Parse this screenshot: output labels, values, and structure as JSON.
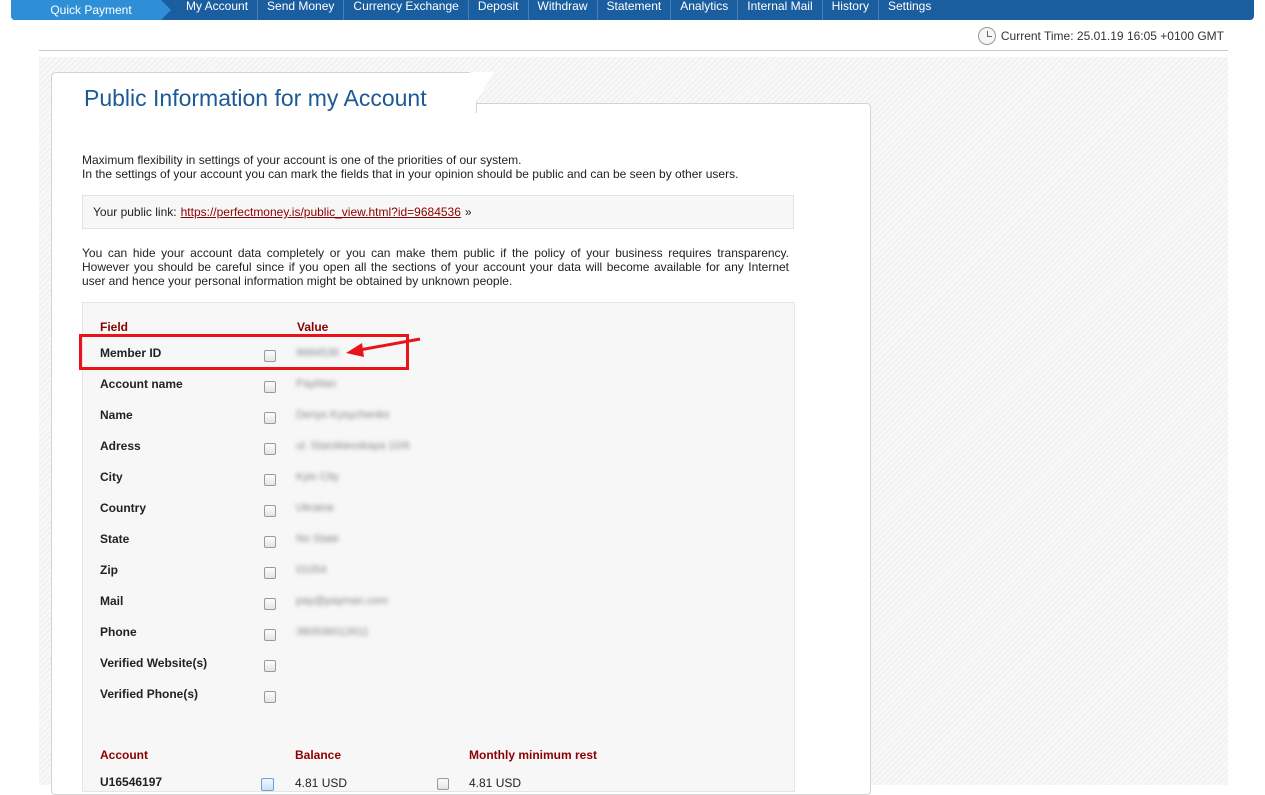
{
  "nav": {
    "quick_payment": "Quick Payment",
    "items": [
      "My Account",
      "Send Money",
      "Currency Exchange",
      "Deposit",
      "Withdraw",
      "Statement",
      "Analytics",
      "Internal Mail",
      "History",
      "Settings"
    ]
  },
  "header": {
    "current_time": "Current Time: 25.01.19 16:05 +0100 GMT"
  },
  "page": {
    "title": "Public Information for my Account",
    "intro_line1": "Maximum flexibility in settings of your account is one of the priorities of our system.",
    "intro_line2": "In the settings of your account you can mark the fields that in your opinion should be public and can be seen by other users.",
    "public_link_label": "Your public link:",
    "public_link_url": "https://perfectmoney.is/public_view.html?id=9684536",
    "public_link_suffix": "»",
    "warning": "You can hide your account data completely or you can make them public if the policy of your business requires transparency. However you should be careful since if you open all the sections of your account your data will become available for any Internet user and hence your personal information might be obtained by unknown people."
  },
  "fields_table": {
    "header_field": "Field",
    "header_value": "Value",
    "rows": [
      {
        "label": "Member ID",
        "value": "9684536"
      },
      {
        "label": "Account name",
        "value": "PayMan"
      },
      {
        "label": "Name",
        "value": "Denys Kysychenko"
      },
      {
        "label": "Adress",
        "value": "ul. Starokievskaya 10/6"
      },
      {
        "label": "City",
        "value": "Kyiv City"
      },
      {
        "label": "Country",
        "value": "Ukraine"
      },
      {
        "label": "State",
        "value": "No State"
      },
      {
        "label": "Zip",
        "value": "01054"
      },
      {
        "label": "Mail",
        "value": "pay@payman.com"
      },
      {
        "label": "Phone",
        "value": "380936012611"
      },
      {
        "label": "Verified Website(s)",
        "value": ""
      },
      {
        "label": "Verified Phone(s)",
        "value": ""
      }
    ]
  },
  "accounts_table": {
    "header_account": "Account",
    "header_balance": "Balance",
    "header_min_rest": "Monthly minimum rest",
    "rows": [
      {
        "account": "U16546197",
        "balance": "4.81 USD",
        "min_rest": "4.81 USD"
      }
    ]
  },
  "colors": {
    "nav_bg": "#1a5ea0",
    "quick_payment_bg": "#2f8fd6",
    "title": "#1b5a96",
    "column_header": "#8b0000",
    "annotation": "#e8141a"
  }
}
